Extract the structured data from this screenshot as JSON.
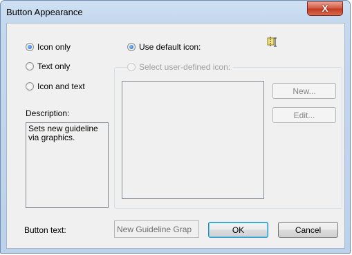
{
  "window": {
    "title": "Button Appearance",
    "close_label": "X"
  },
  "display_mode": {
    "options": [
      "Icon only",
      "Text only",
      "Icon and text"
    ],
    "selected": "Icon only"
  },
  "icon_source": {
    "default_label": "Use default icon:",
    "user_defined_label": "Select user-defined icon:",
    "selected": "default"
  },
  "icon_buttons": {
    "new_label": "New...",
    "edit_label": "Edit..."
  },
  "description": {
    "label": "Description:",
    "text_line1": "Sets new guideline",
    "text_line2": "via graphics."
  },
  "button_text": {
    "label": "Button text:",
    "value": "New Guideline Grap"
  },
  "footer": {
    "ok_label": "OK",
    "cancel_label": "Cancel"
  },
  "default_icon": {
    "icon_name": "guideline-icon"
  }
}
